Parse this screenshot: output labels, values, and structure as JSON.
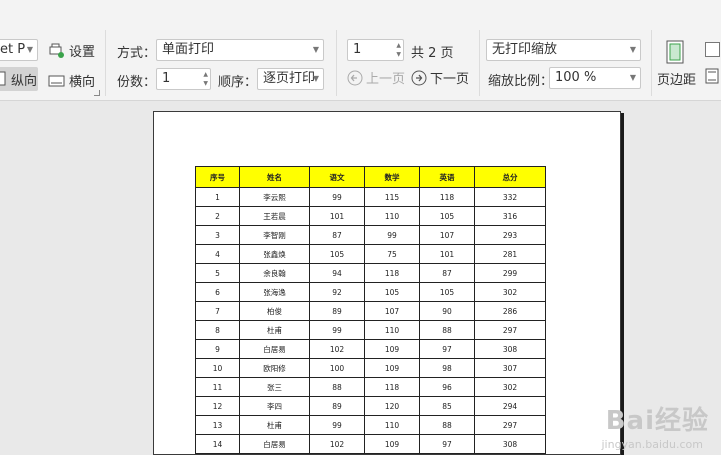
{
  "toolbar": {
    "printer_combo": "et P",
    "settings_label": "设置",
    "portrait_label": "纵向",
    "landscape_label": "横向",
    "mode_label": "方式：",
    "mode_value": "单面打印",
    "copies_label": "份数：",
    "copies_value": "1",
    "order_label": "顺序：",
    "order_value": "逐页打印",
    "page_value": "1",
    "page_total": "共 2 页",
    "prev_page": "上一页",
    "next_page": "下一页",
    "scale_mode": "无打印缩放",
    "zoom_label": "缩放比例：",
    "zoom_value": "100 %",
    "margins_label": "页边距"
  },
  "table": {
    "headers": [
      "序号",
      "姓名",
      "语文",
      "数学",
      "英语",
      "总分"
    ],
    "rows": [
      [
        "1",
        "李云熙",
        "99",
        "115",
        "118",
        "332"
      ],
      [
        "2",
        "王若晨",
        "101",
        "110",
        "105",
        "316"
      ],
      [
        "3",
        "李智刚",
        "87",
        "99",
        "107",
        "293"
      ],
      [
        "4",
        "张鑫焕",
        "105",
        "75",
        "101",
        "281"
      ],
      [
        "5",
        "余良翰",
        "94",
        "118",
        "87",
        "299"
      ],
      [
        "6",
        "张海逸",
        "92",
        "105",
        "105",
        "302"
      ],
      [
        "7",
        "柏俊",
        "89",
        "107",
        "90",
        "286"
      ],
      [
        "8",
        "杜甫",
        "99",
        "110",
        "88",
        "297"
      ],
      [
        "9",
        "白居易",
        "102",
        "109",
        "97",
        "308"
      ],
      [
        "10",
        "欧阳修",
        "100",
        "109",
        "98",
        "307"
      ],
      [
        "11",
        "张三",
        "88",
        "118",
        "96",
        "302"
      ],
      [
        "12",
        "李四",
        "89",
        "120",
        "85",
        "294"
      ],
      [
        "13",
        "杜甫",
        "99",
        "110",
        "88",
        "297"
      ],
      [
        "14",
        "白居易",
        "102",
        "109",
        "97",
        "308"
      ]
    ]
  },
  "watermark": {
    "main": "Bai经验",
    "sub": "jingyan.baidu.com"
  }
}
